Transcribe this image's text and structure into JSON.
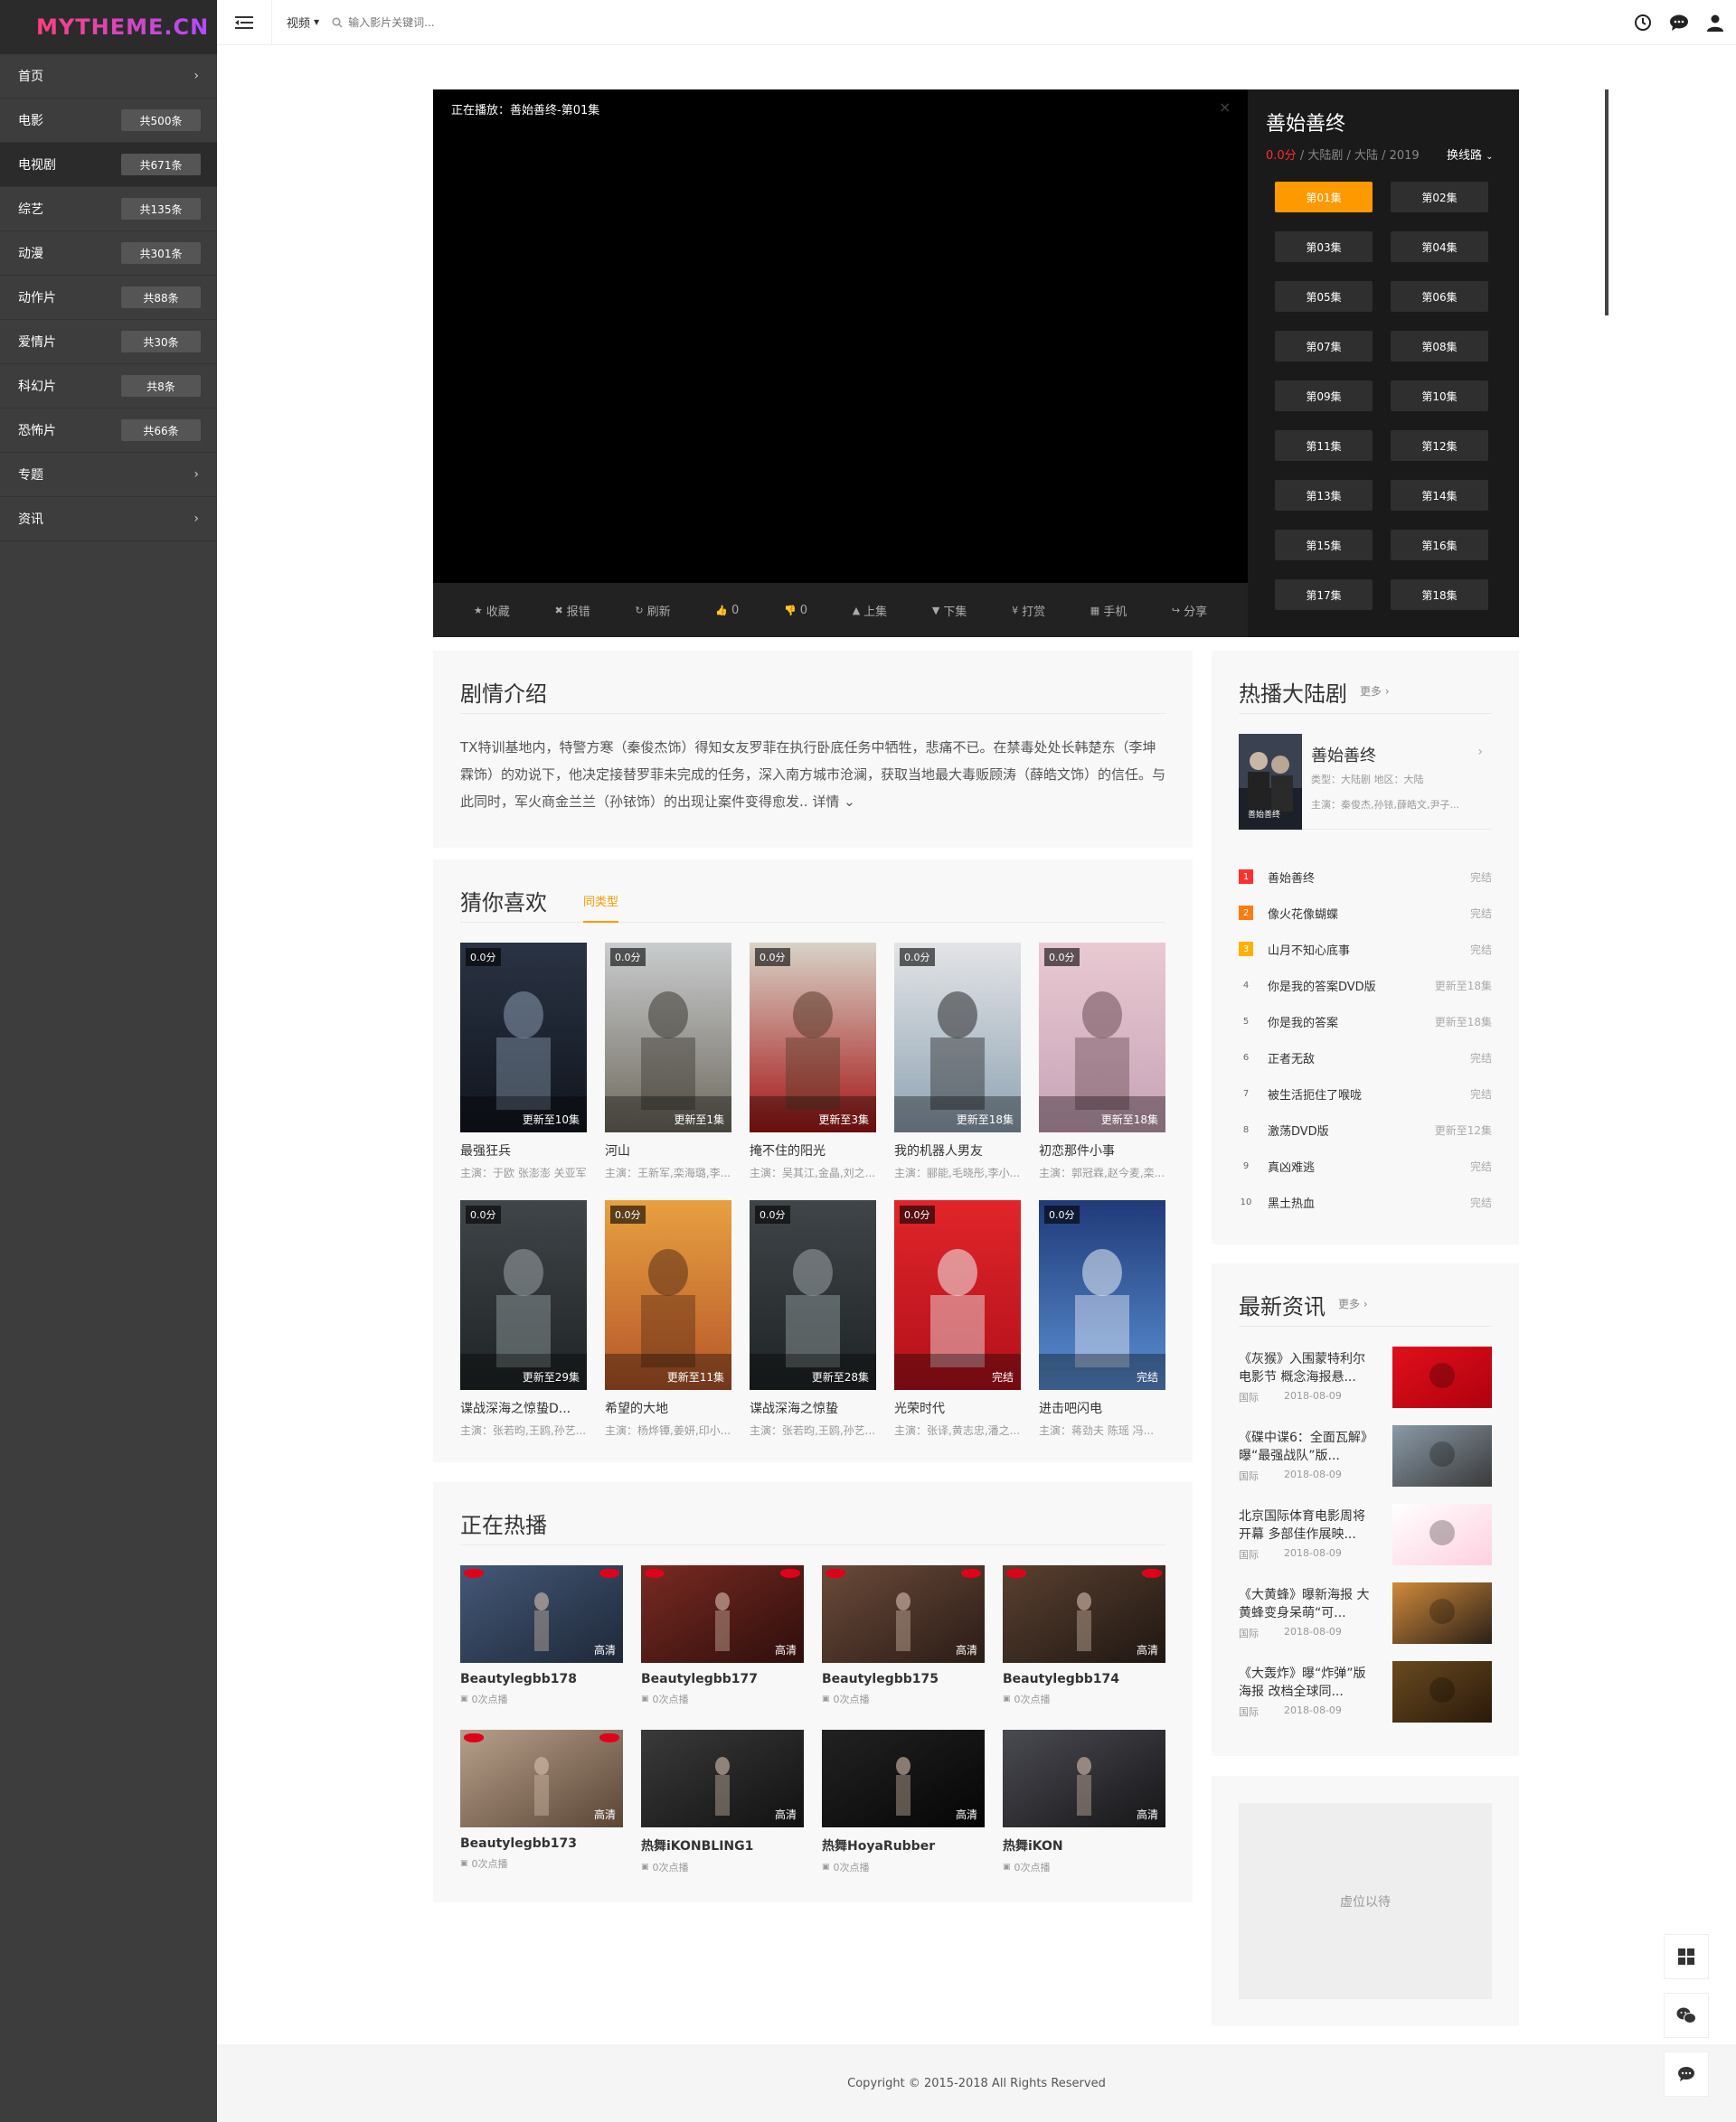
{
  "brand": {
    "logo": "MYTHEME.CN"
  },
  "sidebar": {
    "items": [
      {
        "label": "首页",
        "badge": "",
        "chevron": true,
        "active": false
      },
      {
        "label": "电影",
        "badge": "共500条",
        "chevron": false,
        "active": false
      },
      {
        "label": "电视剧",
        "badge": "共671条",
        "chevron": false,
        "active": true
      },
      {
        "label": "综艺",
        "badge": "共135条",
        "chevron": false,
        "active": false
      },
      {
        "label": "动漫",
        "badge": "共301条",
        "chevron": false,
        "active": false
      },
      {
        "label": "动作片",
        "badge": "共88条",
        "chevron": false,
        "active": false
      },
      {
        "label": "爱情片",
        "badge": "共30条",
        "chevron": false,
        "active": false
      },
      {
        "label": "科幻片",
        "badge": "共8条",
        "chevron": false,
        "active": false
      },
      {
        "label": "恐怖片",
        "badge": "共66条",
        "chevron": false,
        "active": false
      },
      {
        "label": "专题",
        "badge": "",
        "chevron": true,
        "active": false
      },
      {
        "label": "资讯",
        "badge": "",
        "chevron": true,
        "active": false
      }
    ]
  },
  "header": {
    "category": "视频",
    "search_placeholder": "输入影片关键词..."
  },
  "player": {
    "now_playing": "正在播放：善始善终-第01集",
    "toolbar": [
      {
        "icon": "star-icon",
        "label": "收藏"
      },
      {
        "icon": "close-icon",
        "label": "报错"
      },
      {
        "icon": "refresh-icon",
        "label": "刷新"
      },
      {
        "icon": "thumbs-up-icon",
        "label": "0"
      },
      {
        "icon": "thumbs-down-icon",
        "label": "0"
      },
      {
        "icon": "up-icon",
        "label": "上集"
      },
      {
        "icon": "down-icon",
        "label": "下集"
      },
      {
        "icon": "yen-icon",
        "label": "打赏"
      },
      {
        "icon": "qrcode-icon",
        "label": "手机"
      },
      {
        "icon": "share-icon",
        "label": "分享"
      }
    ],
    "panel": {
      "title": "善始善终",
      "score": "0.0分",
      "meta": " / 大陆剧 / 大陆 / 2019",
      "switch_line": "换线路"
    },
    "episodes": [
      "第01集",
      "第02集",
      "第03集",
      "第04集",
      "第05集",
      "第06集",
      "第07集",
      "第08集",
      "第09集",
      "第10集",
      "第11集",
      "第12集",
      "第13集",
      "第14集",
      "第15集",
      "第16集",
      "第17集",
      "第18集"
    ]
  },
  "intro": {
    "title": "剧情介绍",
    "text": "TX特训基地内，特警方寒（秦俊杰饰）得知女友罗菲在执行卧底任务中牺牲，悲痛不已。在禁毒处处长韩楚东（李坤霖饰）的劝说下，他决定接替罗菲未完成的任务，深入南方城市沧澜，获取当地最大毒贩顾涛（薛皓文饰）的信任。与此同时，军火商金兰兰（孙铱饰）的出现让案件变得愈发..",
    "more": " 详情"
  },
  "guess": {
    "title": "猜你喜欢",
    "tag": "同类型",
    "items": [
      {
        "score": "0.0分",
        "status": "更新至10集",
        "name": "最强狂兵",
        "actors": "主演：于欧 张澎澎 关亚军"
      },
      {
        "score": "0.0分",
        "status": "更新至1集",
        "name": "河山",
        "actors": "主演：王新军,栾海璐,李..."
      },
      {
        "score": "0.0分",
        "status": "更新至3集",
        "name": "掩不住的阳光",
        "actors": "主演：吴其江,金晶,刘之..."
      },
      {
        "score": "0.0分",
        "status": "更新至18集",
        "name": "我的机器人男友",
        "actors": "主演：郦能,毛晓彤,李小..."
      },
      {
        "score": "0.0分",
        "status": "更新至18集",
        "name": "初恋那件小事",
        "actors": "主演：郭冠霖,赵今麦,栾..."
      },
      {
        "score": "0.0分",
        "status": "更新至29集",
        "name": "谍战深海之惊蛰D...",
        "actors": "主演：张若昀,王鸥,孙艺..."
      },
      {
        "score": "0.0分",
        "status": "更新至11集",
        "name": "希望的大地",
        "actors": "主演：杨烨镡,姜妍,印小..."
      },
      {
        "score": "0.0分",
        "status": "更新至28集",
        "name": "谍战深海之惊蛰",
        "actors": "主演：张若昀,王鸥,孙艺..."
      },
      {
        "score": "0.0分",
        "status": "完结",
        "name": "光荣时代",
        "actors": "主演：张译,黄志忠,潘之..."
      },
      {
        "score": "0.0分",
        "status": "完结",
        "name": "进击吧闪电",
        "actors": "主演：蒋劲夫 陈瑶 冯..."
      }
    ]
  },
  "hot_now": {
    "title": "正在热播",
    "items": [
      {
        "name": "Beautylegbb178",
        "views": "0次点播",
        "hd": "高清"
      },
      {
        "name": "Beautylegbb177",
        "views": "0次点播",
        "hd": "高清"
      },
      {
        "name": "Beautylegbb175",
        "views": "0次点播",
        "hd": "高清"
      },
      {
        "name": "Beautylegbb174",
        "views": "0次点播",
        "hd": "高清"
      },
      {
        "name": "Beautylegbb173",
        "views": "0次点播",
        "hd": "高清"
      },
      {
        "name": "热舞iKONBLING1",
        "views": "0次点播",
        "hd": "高清"
      },
      {
        "name": "热舞HoyaRubber",
        "views": "0次点播",
        "hd": "高清"
      },
      {
        "name": "热舞iKON",
        "views": "0次点播",
        "hd": "高清"
      }
    ]
  },
  "hot_list": {
    "title": "热播大陆剧",
    "more": "更多",
    "feature": {
      "title": "善始善终",
      "meta1": "类型：大陆剧 地区：大陆",
      "meta2": "主演：秦俊杰,孙铱,薛皓文,尹子..."
    },
    "rank": [
      {
        "n": "1",
        "name": "善始善终",
        "status": "完结"
      },
      {
        "n": "2",
        "name": "像火花像蝴蝶",
        "status": "完结"
      },
      {
        "n": "3",
        "name": "山月不知心底事",
        "status": "完结"
      },
      {
        "n": "4",
        "name": "你是我的答案DVD版",
        "status": "更新至18集"
      },
      {
        "n": "5",
        "name": "你是我的答案",
        "status": "更新至18集"
      },
      {
        "n": "6",
        "name": "正者无敌",
        "status": "完结"
      },
      {
        "n": "7",
        "name": "被生活扼住了喉咙",
        "status": "完结"
      },
      {
        "n": "8",
        "name": "激荡DVD版",
        "status": "更新至12集"
      },
      {
        "n": "9",
        "name": "真凶难逃",
        "status": "完结"
      },
      {
        "n": "10",
        "name": "黑土热血",
        "status": "完结"
      }
    ]
  },
  "news": {
    "title": "最新资讯",
    "more": "更多",
    "items": [
      {
        "title": "《灰猴》入围蒙特利尔电影节 概念海报悬...",
        "cat": "国际",
        "date": "2018-08-09"
      },
      {
        "title": "《碟中谍6：全面瓦解》曝“最强战队”版...",
        "cat": "国际",
        "date": "2018-08-09"
      },
      {
        "title": "北京国际体育电影周将开幕 多部佳作展映...",
        "cat": "国际",
        "date": "2018-08-09"
      },
      {
        "title": "《大黄蜂》曝新海报 大黄蜂变身呆萌“可...",
        "cat": "国际",
        "date": "2018-08-09"
      },
      {
        "title": "《大轰炸》曝“炸弹”版海报 改档全球同...",
        "cat": "国际",
        "date": "2018-08-09"
      }
    ]
  },
  "ad": {
    "text": "虚位以待"
  },
  "footer": {
    "copyright": "Copyright © 2015-2018 All Rights Reserved"
  },
  "colors": {
    "accent": "#ff9900",
    "sidebar_bg": "#3d3d3d",
    "rank1": "#ff3030",
    "rank2": "#ff7a10",
    "rank3": "#ffb000"
  }
}
